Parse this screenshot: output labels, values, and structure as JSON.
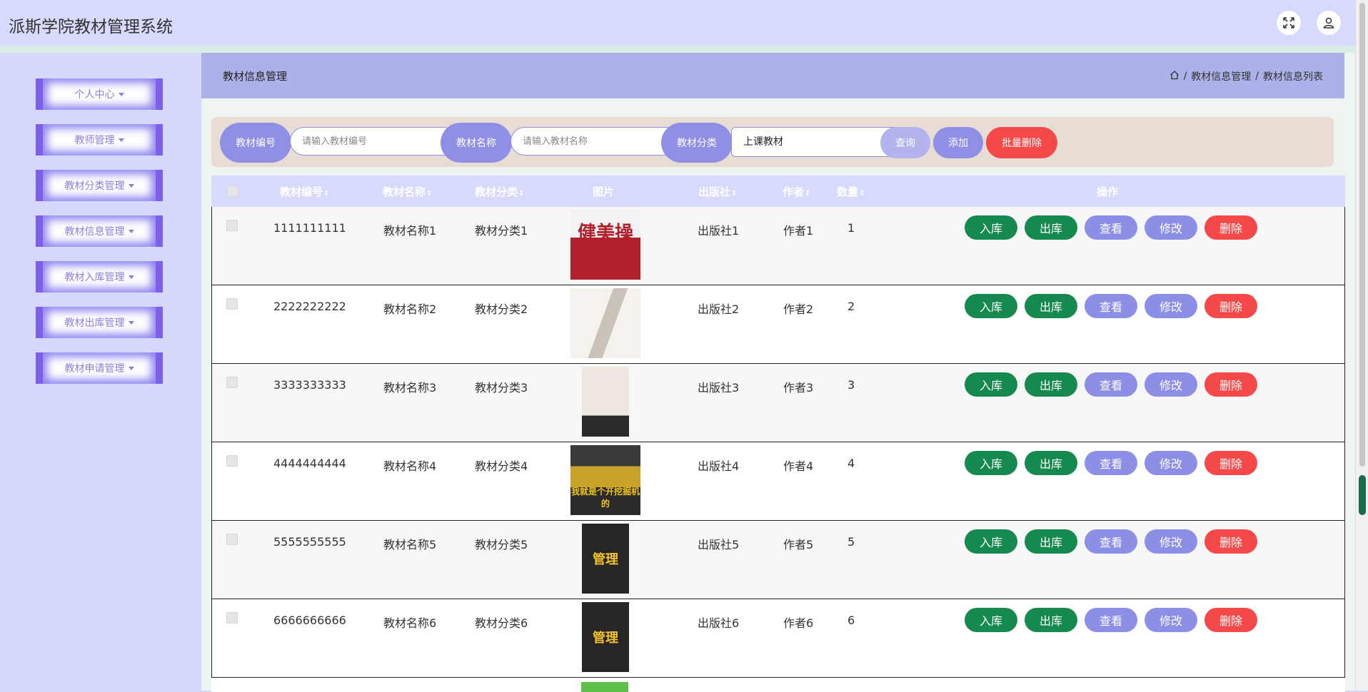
{
  "app": {
    "title": "派斯学院教材管理系统"
  },
  "header_icons": [
    "fullscreen-icon",
    "user-icon"
  ],
  "sidebar": {
    "items": [
      {
        "label": "个人中心"
      },
      {
        "label": "教师管理"
      },
      {
        "label": "教材分类管理"
      },
      {
        "label": "教材信息管理"
      },
      {
        "label": "教材入库管理"
      },
      {
        "label": "教材出库管理"
      },
      {
        "label": "教材申请管理"
      }
    ]
  },
  "page": {
    "title": "教材信息管理",
    "breadcrumb": [
      "教材信息管理",
      "教材信息列表"
    ],
    "breadcrumb_sep": "/"
  },
  "search": {
    "code_label": "教材编号",
    "code_placeholder": "请输入教材编号",
    "name_label": "教材名称",
    "name_placeholder": "请输入教材名称",
    "category_label": "教材分类",
    "category_selected": "上课教材",
    "query_button": "查询",
    "add_button": "添加",
    "batch_delete_button": "批量删除"
  },
  "table": {
    "columns": [
      "教材编号",
      "教材名称",
      "教材分类",
      "图片",
      "出版社",
      "作者",
      "数量",
      "操作"
    ],
    "sort_glyph": "⇕",
    "actions": [
      "入库",
      "出库",
      "查看",
      "修改",
      "删除"
    ],
    "rows": [
      {
        "code": "1111111111",
        "name": "教材名称1",
        "category": "教材分类1",
        "publisher": "出版社1",
        "author": "作者1",
        "qty": "1",
        "cover_text": "健美操"
      },
      {
        "code": "2222222222",
        "name": "教材名称2",
        "category": "教材分类2",
        "publisher": "出版社2",
        "author": "作者2",
        "qty": "2",
        "cover_text": ""
      },
      {
        "code": "3333333333",
        "name": "教材名称3",
        "category": "教材分类3",
        "publisher": "出版社3",
        "author": "作者3",
        "qty": "3",
        "cover_text": ""
      },
      {
        "code": "4444444444",
        "name": "教材名称4",
        "category": "教材分类4",
        "publisher": "出版社4",
        "author": "作者4",
        "qty": "4",
        "cover_text": "我就是个开挖掘机的"
      },
      {
        "code": "5555555555",
        "name": "教材名称5",
        "category": "教材分类5",
        "publisher": "出版社5",
        "author": "作者5",
        "qty": "5",
        "cover_text": "管理"
      },
      {
        "code": "6666666666",
        "name": "教材名称6",
        "category": "教材分类6",
        "publisher": "出版社6",
        "author": "作者6",
        "qty": "6",
        "cover_text": "管理"
      }
    ]
  },
  "colors": {
    "primary": "#8f8fe6",
    "success": "#168a4e",
    "danger": "#f54848",
    "sidebar_accent": "#7b61e8"
  }
}
